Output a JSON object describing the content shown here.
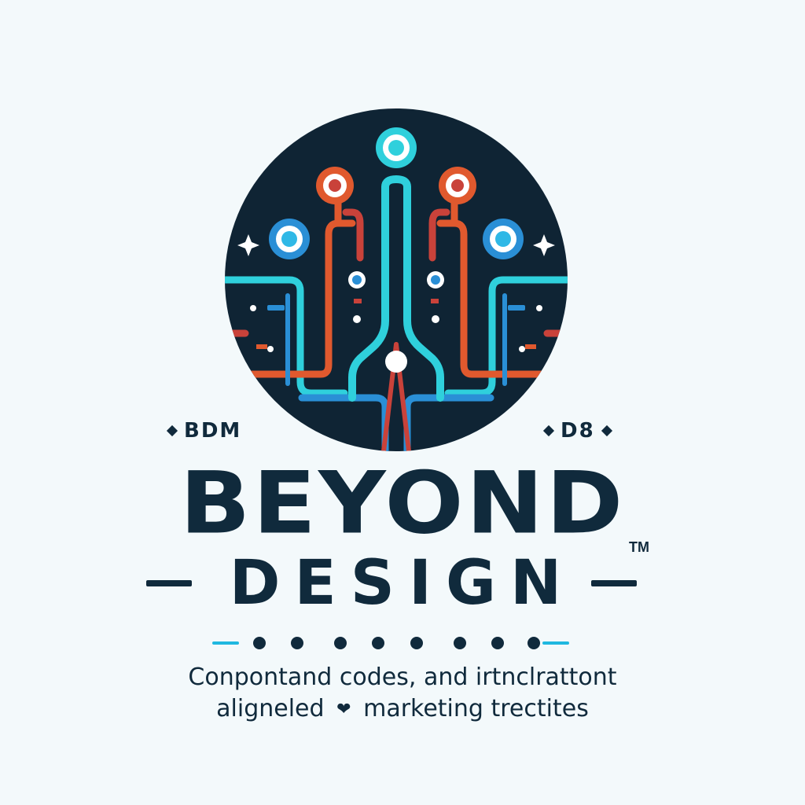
{
  "logo": {
    "icon": "circuit-board-emblem",
    "colors": {
      "circle": "#0f2434",
      "cyan": "#2fd0dc",
      "blue": "#2a8fd6",
      "orange": "#e0592e",
      "red": "#c9423a",
      "white": "#ffffff"
    }
  },
  "labels": {
    "left": "BDM",
    "right": "D8"
  },
  "title": {
    "main": "BEYOND",
    "sub": "DESIGN",
    "trademark": "TM"
  },
  "tagline": {
    "line1": "Conpontand codes, and irtnclrattont",
    "line2_start": "aligneled",
    "line2_end": "marketing trectites",
    "heart_icon": "heart-icon"
  }
}
